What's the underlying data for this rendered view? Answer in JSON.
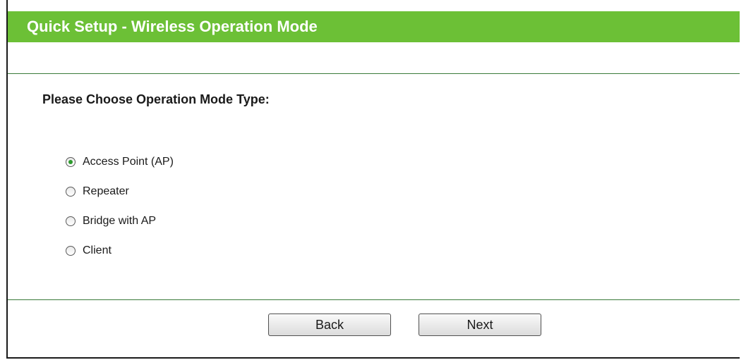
{
  "header": {
    "title": "Quick Setup - Wireless Operation Mode"
  },
  "form": {
    "question": "Please Choose Operation Mode Type:",
    "options": [
      {
        "label": "Access Point (AP)",
        "checked": true
      },
      {
        "label": "Repeater",
        "checked": false
      },
      {
        "label": "Bridge with AP",
        "checked": false
      },
      {
        "label": "Client",
        "checked": false
      }
    ]
  },
  "buttons": {
    "back_label": "Back",
    "next_label": "Next"
  },
  "colors": {
    "header_bg": "#6cc036",
    "header_text": "#ffffff",
    "rule": "#3a7a3a",
    "radio_dot": "#2c9a2c"
  }
}
